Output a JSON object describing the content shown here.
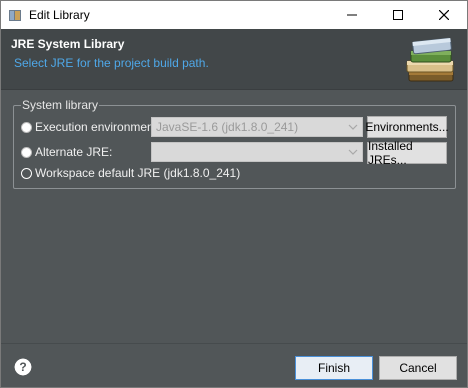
{
  "window": {
    "title": "Edit Library"
  },
  "banner": {
    "title": "JRE System Library",
    "description": "Select JRE for the project build path."
  },
  "group": {
    "label": "System library",
    "options": [
      {
        "label": "Execution environment:",
        "combo_value": "JavaSE-1.6 (jdk1.8.0_241)",
        "button": "Environments...",
        "selected": false,
        "enabled": false
      },
      {
        "label": "Alternate JRE:",
        "combo_value": "",
        "button": "Installed JREs...",
        "selected": false,
        "enabled": false
      },
      {
        "label": "Workspace default JRE (jdk1.8.0_241)",
        "selected": true
      }
    ]
  },
  "footer": {
    "finish": "Finish",
    "cancel": "Cancel"
  },
  "icons": {
    "app": "eclipse-library-icon",
    "banner": "library-books-icon",
    "help": "help-icon"
  },
  "colors": {
    "accent": "#4fa8e8",
    "body_bg": "#515658",
    "banner_bg": "#424749"
  }
}
